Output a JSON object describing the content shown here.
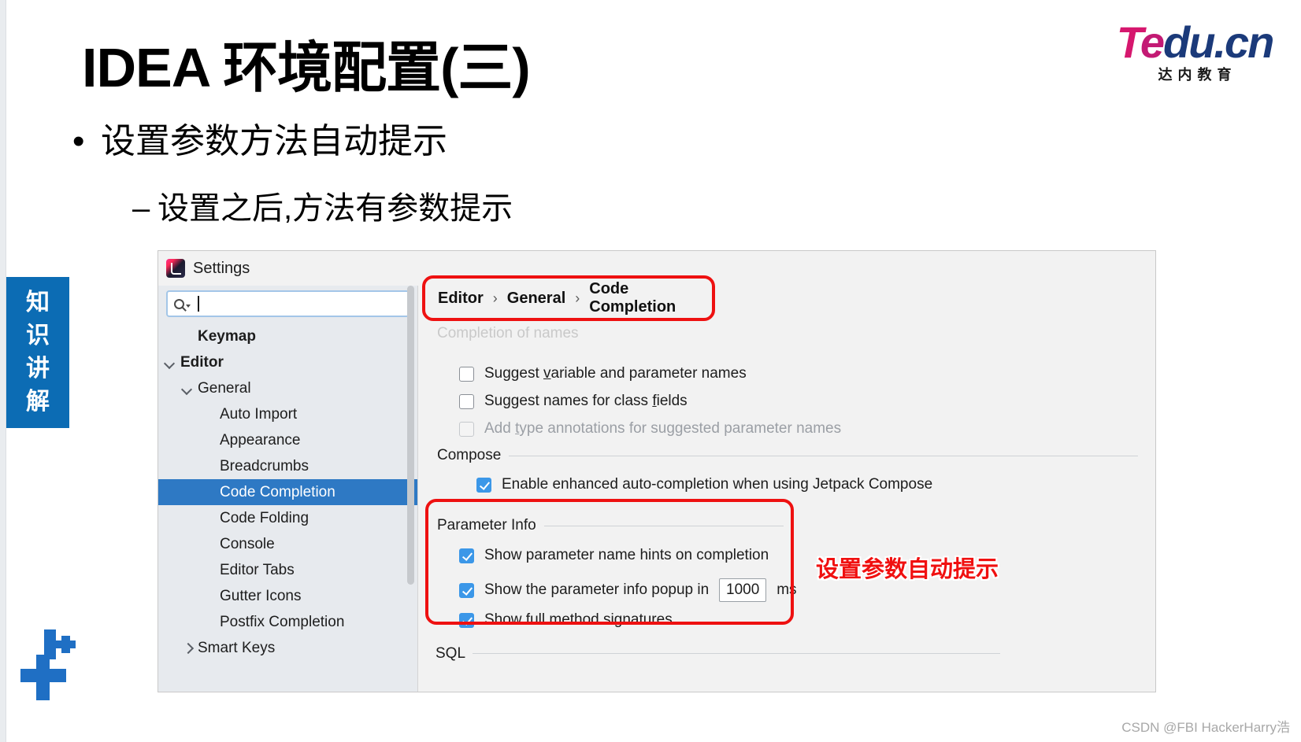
{
  "slide": {
    "title": "IDEA 环境配置(三)",
    "bullet_1": "设置参数方法自动提示",
    "bullet_2": "设置之后,方法有参数提示",
    "bullet_marker": "•",
    "sub_bullet_marker": "–",
    "badge_chars": [
      "知",
      "识",
      "讲",
      "解"
    ],
    "annotation_note": "设置参数自动提示",
    "watermark": "CSDN @FBI HackerHarry浩",
    "colors": {
      "badge_blue": "#0c6cb4",
      "annotation_red": "#f01010",
      "highlight_blue": "#2e79c4",
      "checkbox_blue": "#3b97e8",
      "red_outline": "#ee1111"
    }
  },
  "logo": {
    "word_t": "T",
    "word_e": "e",
    "word_rest": "du.cn",
    "subtitle": "达内教育"
  },
  "dialog": {
    "title": "Settings",
    "search": {
      "value": "",
      "placeholder": ""
    },
    "tree": [
      {
        "label": "Keymap",
        "indent": 1,
        "bold": true,
        "chevron": "none",
        "selected": false
      },
      {
        "label": "Editor",
        "indent": 0,
        "bold": true,
        "chevron": "down",
        "selected": false
      },
      {
        "label": "General",
        "indent": 1,
        "bold": false,
        "chevron": "down",
        "selected": false
      },
      {
        "label": "Auto Import",
        "indent": 2,
        "bold": false,
        "chevron": "none",
        "selected": false
      },
      {
        "label": "Appearance",
        "indent": 2,
        "bold": false,
        "chevron": "none",
        "selected": false
      },
      {
        "label": "Breadcrumbs",
        "indent": 2,
        "bold": false,
        "chevron": "none",
        "selected": false
      },
      {
        "label": "Code Completion",
        "indent": 2,
        "bold": false,
        "chevron": "none",
        "selected": true
      },
      {
        "label": "Code Folding",
        "indent": 2,
        "bold": false,
        "chevron": "none",
        "selected": false
      },
      {
        "label": "Console",
        "indent": 2,
        "bold": false,
        "chevron": "none",
        "selected": false
      },
      {
        "label": "Editor Tabs",
        "indent": 2,
        "bold": false,
        "chevron": "none",
        "selected": false
      },
      {
        "label": "Gutter Icons",
        "indent": 2,
        "bold": false,
        "chevron": "none",
        "selected": false
      },
      {
        "label": "Postfix Completion",
        "indent": 2,
        "bold": false,
        "chevron": "none",
        "selected": false
      },
      {
        "label": "Smart Keys",
        "indent": 1,
        "bold": false,
        "chevron": "right",
        "selected": false
      }
    ],
    "breadcrumb": [
      "Editor",
      "General",
      "Code Completion"
    ],
    "breadcrumb_separator": "›",
    "ghost_section": "Completion of names",
    "checkboxes_names": [
      {
        "label": "Suggest variable and parameter names",
        "checked": false,
        "disabled": false
      },
      {
        "label": "Suggest names for class fields",
        "checked": false,
        "disabled": false
      },
      {
        "label": "Add type annotations for suggested parameter names",
        "checked": false,
        "disabled": true
      }
    ],
    "compose": {
      "group_label": "Compose",
      "checkbox": {
        "label": "Enable enhanced auto-completion when using Jetpack Compose",
        "checked": true
      }
    },
    "parameter_info": {
      "group_label": "Parameter Info",
      "row_1": {
        "label": "Show parameter name hints on completion",
        "checked": true
      },
      "row_2": {
        "label_before": "Show the parameter info popup in",
        "value": "1000",
        "unit": "ms",
        "checked": true
      },
      "row_3": {
        "label": "Show full method signatures",
        "checked": true
      }
    },
    "sql_group_label": "SQL"
  }
}
